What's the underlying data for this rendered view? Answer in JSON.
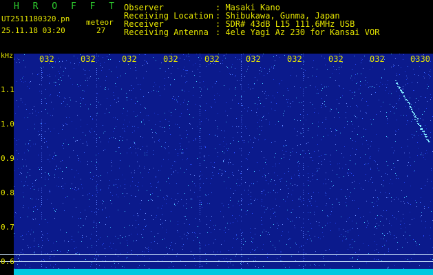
{
  "header": {
    "app_title": "H R O F F T",
    "filename": "UT2511180320.pn",
    "mode_label": "meteor",
    "datetime": "25.11.18 03:20",
    "count": "27",
    "info": [
      {
        "label": "Observer",
        "value": ": Masaki Kano"
      },
      {
        "label": "Receiving Location",
        "value": ": Shibukawa, Gunma, Japan"
      },
      {
        "label": "Receiver",
        "value": ": SDR# 43dB L15 111.6MHz USB"
      },
      {
        "label": "Receiving Antenna",
        "value": ": 4ele Yagi Az 230 for Kansai VOR"
      }
    ]
  },
  "spectrogram": {
    "unit_label": "kHz",
    "y_ticks": [
      "1.1",
      "1.0",
      "0.9",
      "0.8",
      "0.7",
      "0.6"
    ],
    "x_ticks": [
      "032",
      "032",
      "032",
      "032",
      "032",
      "032",
      "032",
      "032",
      "032",
      "0330"
    ],
    "colors": {
      "background": "#0b1a8c",
      "header_text": "#e6e600",
      "title_text": "#2fd02f",
      "floor": "#00c8e0"
    }
  }
}
